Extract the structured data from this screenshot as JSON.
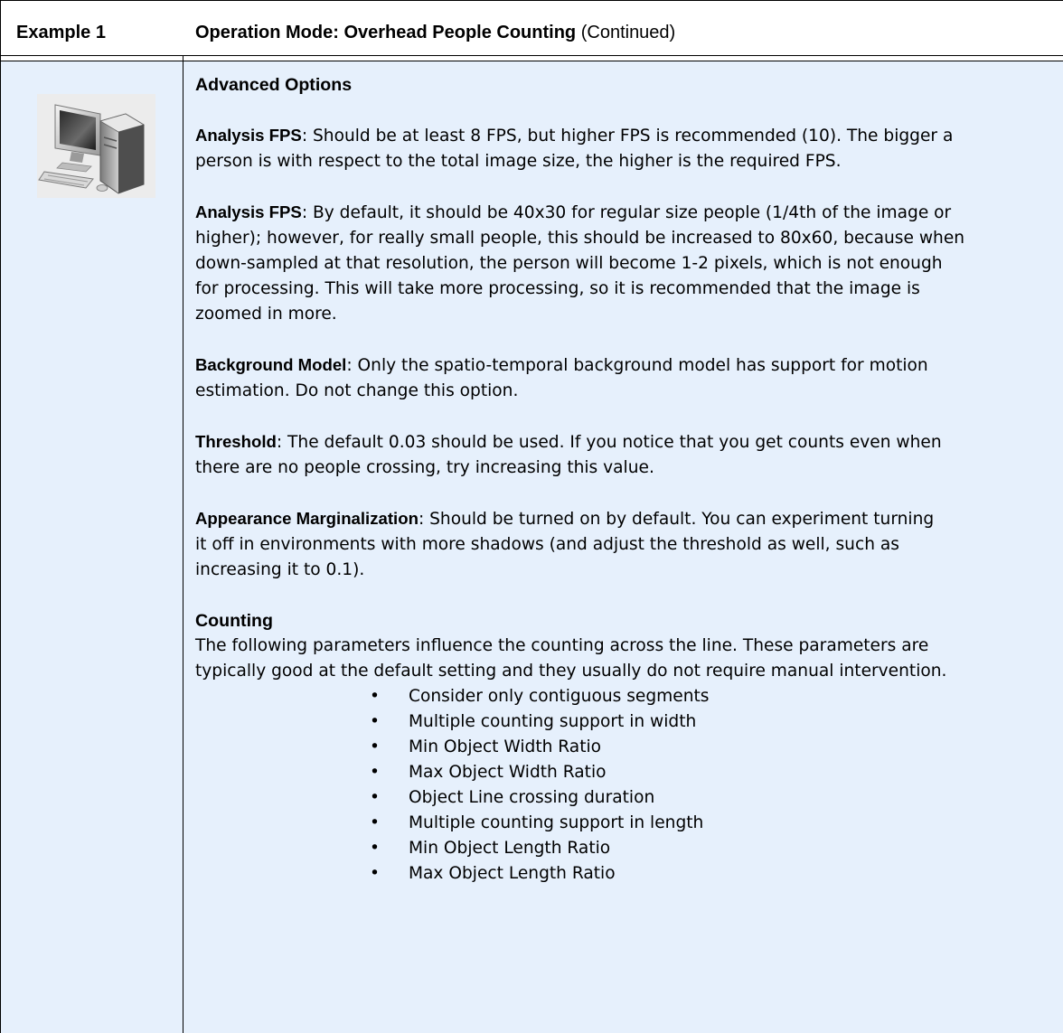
{
  "header": {
    "example_label": "Example 1",
    "mode_title_bold": "Operation Mode: Overhead People Counting",
    "mode_title_suffix": " (Continued)"
  },
  "icon": {
    "name": "computer-icon"
  },
  "content": {
    "advanced_heading": "Advanced Options",
    "paragraphs": [
      {
        "term": "Analysis FPS",
        "lines": [
          ": Should be at least 8 FPS, but higher FPS is recommended (10). The bigger a",
          "person is with respect to the total image size, the higher is the required FPS."
        ]
      },
      {
        "term": "Analysis FPS",
        "lines": [
          ": By default, it should be 40x30 for regular size people (1/4th of the image or",
          "higher); however, for really small people, this should be increased to 80x60, because when",
          "down-sampled at that resolution, the person will become 1-2 pixels, which is not enough",
          "for processing. This will take more processing, so it is recommended that the image is",
          "zoomed in more."
        ]
      },
      {
        "term": "Background Model",
        "lines": [
          ": Only the spatio-temporal background model has support for motion",
          "estimation. Do not change this option."
        ]
      },
      {
        "term": "Threshold",
        "lines": [
          ": The default 0.03 should be used. If you notice that you get counts even when",
          "there are no people crossing, try increasing this value."
        ]
      },
      {
        "term": "Appearance Marginalization",
        "lines": [
          ": Should be turned on by default. You can experiment turning",
          "it off in environments with more shadows (and adjust the threshold as well, such as",
          "increasing it to 0.1)."
        ]
      }
    ],
    "counting_heading": "Counting",
    "counting_lines": [
      "The following parameters influence the counting across the line. These parameters are",
      "typically good at the default setting and they usually do not require manual intervention."
    ],
    "bullet_glyph": "•",
    "bullets": [
      "Consider only contiguous segments",
      "Multiple counting support in width",
      "Min Object Width Ratio",
      "Max Object Width Ratio",
      "Object Line crossing duration",
      "Multiple counting support in length",
      "Min Object Length Ratio",
      "Max Object Length Ratio"
    ]
  },
  "colors": {
    "cell_background": "#e6f0fc",
    "border": "#000000"
  }
}
